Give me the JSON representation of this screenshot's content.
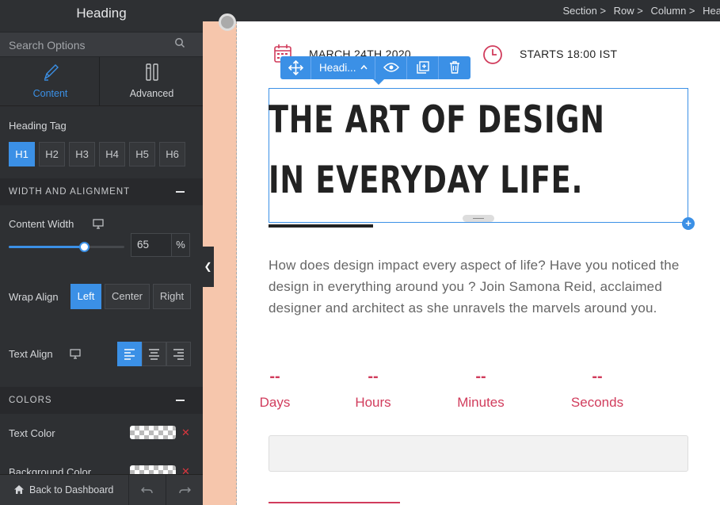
{
  "sidebar": {
    "title": "Heading",
    "search_placeholder": "Search Options",
    "tabs": [
      {
        "label": "Content",
        "icon": "pen-icon",
        "active": true
      },
      {
        "label": "Advanced",
        "icon": "tools-icon",
        "active": false
      }
    ],
    "heading_tag": {
      "label": "Heading Tag",
      "options": [
        "H1",
        "H2",
        "H3",
        "H4",
        "H5",
        "H6"
      ],
      "selected": "H1"
    },
    "width_section": {
      "title": "WIDTH AND ALIGNMENT",
      "content_width_label": "Content Width",
      "content_width_value": "65",
      "content_width_unit": "%",
      "wrap_align_label": "Wrap Align",
      "wrap_options": [
        "Left",
        "Center",
        "Right"
      ],
      "wrap_selected": "Left",
      "text_align_label": "Text Align",
      "text_align_selected": "left"
    },
    "colors_section": {
      "title": "COLORS",
      "text_color_label": "Text Color",
      "background_color_label": "Background Color"
    },
    "footer": {
      "back_label": "Back to Dashboard"
    }
  },
  "breadcrumb": [
    "Section >",
    "Row >",
    "Column >",
    "Hea"
  ],
  "canvas": {
    "date_text": "MARCH 24TH 2020",
    "time_text": "STARTS 18:00 IST",
    "toolbar_label": "Headi...",
    "heading_line1": "THE ART OF DESIGN",
    "heading_line2": "IN EVERYDAY LIFE.",
    "paragraph": "How does design impact every aspect of life? Have you noticed the design in everything around you ? Join Samona Reid, acclaimed designer and architect as she unravels the marvels around you.",
    "countdown": [
      {
        "value": "--",
        "label": "Days"
      },
      {
        "value": "--",
        "label": "Hours"
      },
      {
        "value": "--",
        "label": "Minutes"
      },
      {
        "value": "--",
        "label": "Seconds"
      }
    ]
  },
  "colors": {
    "accent": "#3b90e6",
    "brand_pink": "#d13c5c",
    "sidebar_bg": "#2e3033",
    "gutter": "#f6c6ac"
  }
}
